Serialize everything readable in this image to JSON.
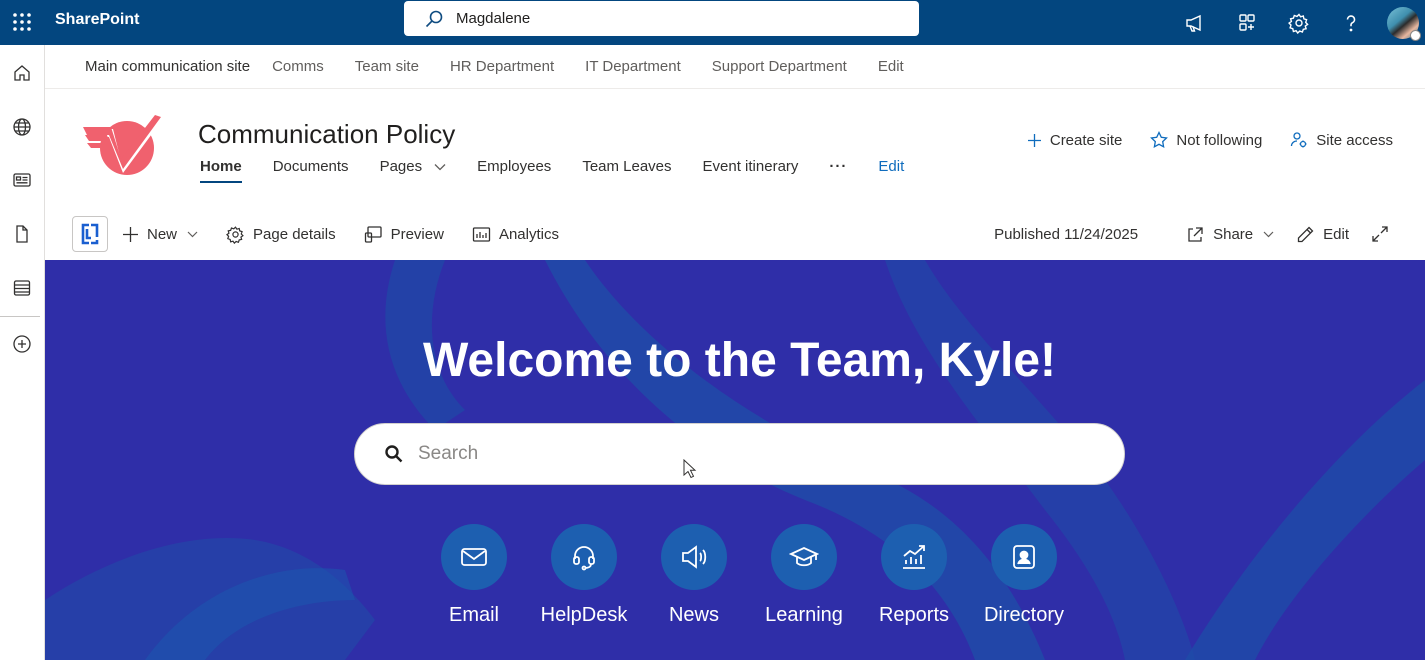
{
  "suite": {
    "app_name": "SharePoint",
    "search_value": "Magdalene"
  },
  "topbar_icons": [
    "megaphone-icon",
    "apps-icon",
    "gear-icon",
    "help-icon"
  ],
  "hub_nav": {
    "home": "Main communication site",
    "links": [
      "Comms",
      "Team site",
      "HR Department",
      "IT Department",
      "Support Department",
      "Edit"
    ]
  },
  "site": {
    "title": "Communication Policy",
    "nav": {
      "home": "Home",
      "documents": "Documents",
      "pages": "Pages",
      "employees": "Employees",
      "team_leaves": "Team Leaves",
      "event_itinerary": "Event itinerary",
      "more": "···",
      "edit": "Edit"
    },
    "actions": {
      "create_site": "Create site",
      "not_following": "Not following",
      "site_access": "Site access"
    }
  },
  "command_bar": {
    "new": "New",
    "page_details": "Page details",
    "preview": "Preview",
    "analytics": "Analytics",
    "published": "Published 11/24/2025",
    "share": "Share",
    "edit": "Edit"
  },
  "hero": {
    "welcome": "Welcome to the Team, Kyle!",
    "search_placeholder": "Search",
    "quick_links": [
      {
        "label": "Email",
        "icon": "mail-icon"
      },
      {
        "label": "HelpDesk",
        "icon": "headset-icon"
      },
      {
        "label": "News",
        "icon": "speaker-icon"
      },
      {
        "label": "Learning",
        "icon": "graduation-cap-icon"
      },
      {
        "label": "Reports",
        "icon": "chart-trend-icon"
      },
      {
        "label": "Directory",
        "icon": "contact-card-icon"
      }
    ]
  },
  "colors": {
    "suite_bar": "#03467f",
    "hero_bg": "#2f2ea8",
    "quick_link_circle": "#1d5fb0",
    "link_blue": "#0f6cbd",
    "logo_red": "#f0616e"
  }
}
